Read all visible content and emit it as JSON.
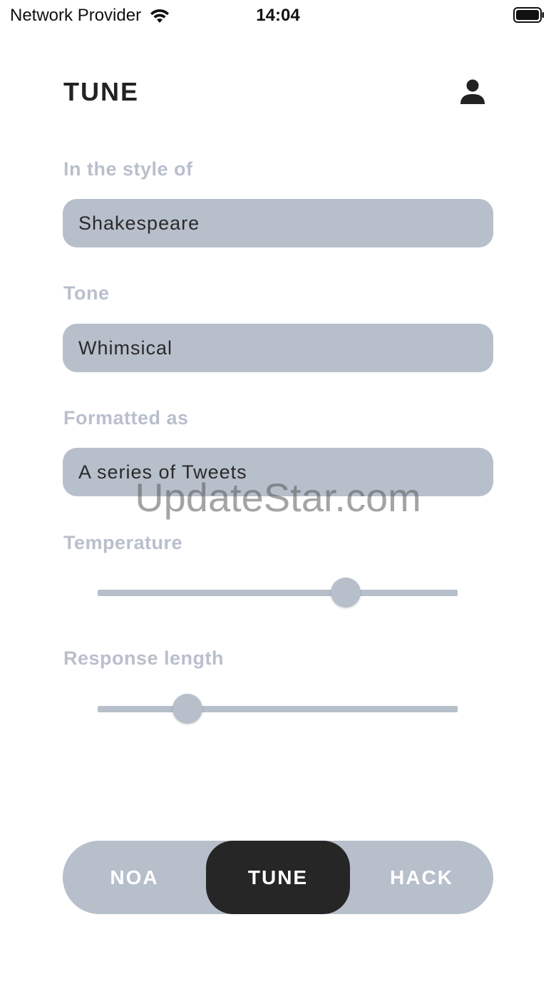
{
  "status_bar": {
    "carrier": "Network Provider",
    "time": "14:04",
    "icons": [
      "wifi-icon",
      "battery-icon"
    ]
  },
  "header": {
    "title": "TUNE",
    "profile_icon": "person-icon"
  },
  "form": {
    "style": {
      "label": "In the style of",
      "value": "Shakespeare"
    },
    "tone": {
      "label": "Tone",
      "value": "Whimsical"
    },
    "format": {
      "label": "Formatted as",
      "value": "A series of Tweets"
    },
    "temperature": {
      "label": "Temperature",
      "value": 0.69
    },
    "response_length": {
      "label": "Response length",
      "value": 0.25
    }
  },
  "nav": {
    "tabs": [
      {
        "label": "NOA",
        "selected": false
      },
      {
        "label": "TUNE",
        "selected": true
      },
      {
        "label": "HACK",
        "selected": false
      }
    ]
  },
  "watermark": "UpdateStar.com",
  "colors": {
    "field_bg": "#b7bfcb",
    "label": "#b9bfcc",
    "active_tab": "#262626",
    "text": "#222222"
  }
}
